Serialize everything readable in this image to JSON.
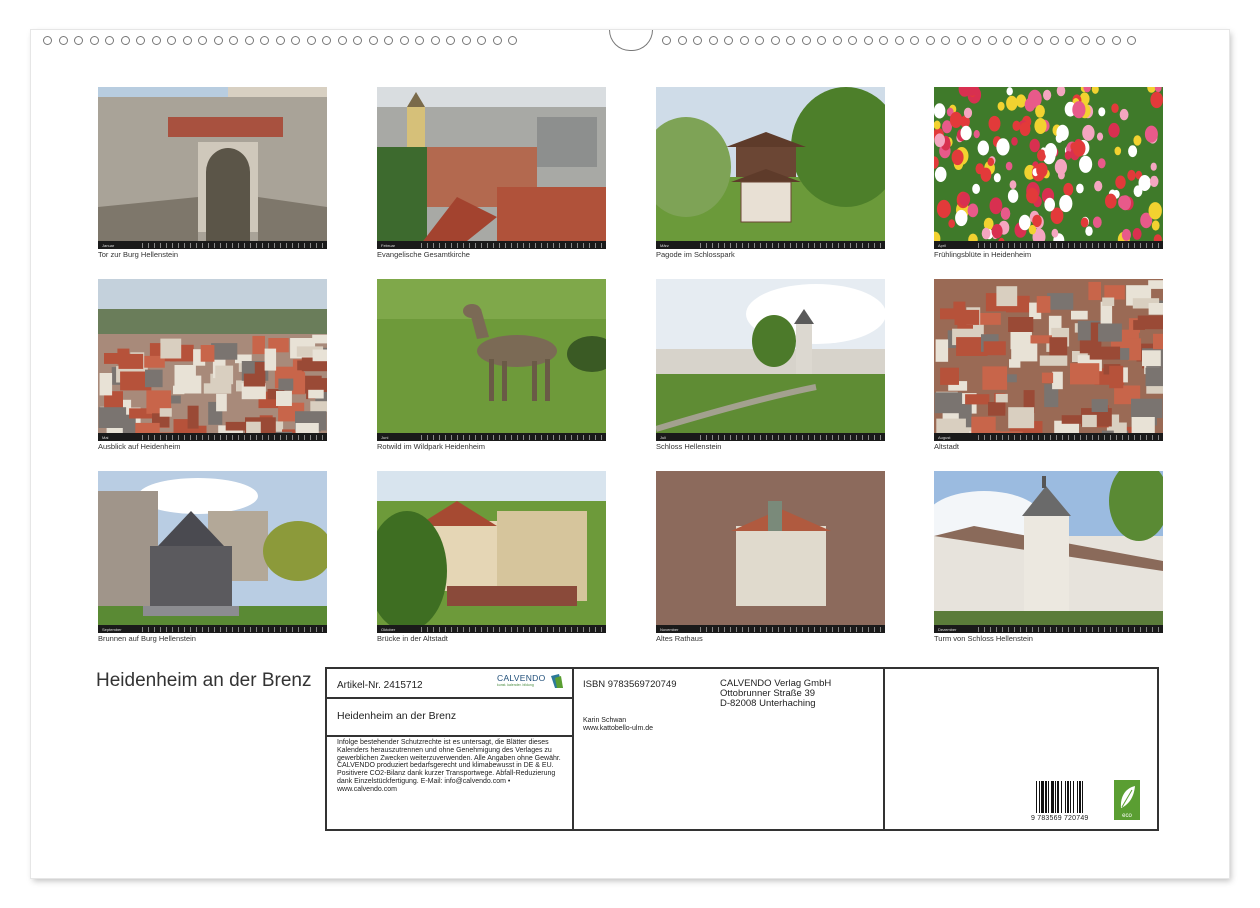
{
  "title": "Heidenheim an der Brenz",
  "photos": [
    {
      "caption": "Tor zur Burg Hellenstein",
      "month": "Januar",
      "scene": "gate"
    },
    {
      "caption": "Evangelische Gesamtkirche",
      "month": "Februar",
      "scene": "town"
    },
    {
      "caption": "Pagode im Schlosspark",
      "month": "März",
      "scene": "pagoda"
    },
    {
      "caption": "Frühlingsblüte in Heidenheim",
      "month": "April",
      "scene": "tulips"
    },
    {
      "caption": "Ausblick auf Heidenheim",
      "month": "Mai",
      "scene": "view"
    },
    {
      "caption": "Rotwild im Wildpark Heidenheim",
      "month": "Juni",
      "scene": "deer"
    },
    {
      "caption": "Schloss Hellenstein",
      "month": "Juli",
      "scene": "castle"
    },
    {
      "caption": "Altstadt",
      "month": "August",
      "scene": "roofs"
    },
    {
      "caption": "Brunnen auf Burg Hellenstein",
      "month": "September",
      "scene": "fountain"
    },
    {
      "caption": "Brücke in der Altstadt",
      "month": "Oktober",
      "scene": "bridge"
    },
    {
      "caption": "Altes Rathaus",
      "month": "November",
      "scene": "townhall"
    },
    {
      "caption": "Turm von Schloss Hellenstein",
      "month": "Dezember",
      "scene": "tower"
    }
  ],
  "info": {
    "article": "Artikel-Nr. 2415712",
    "brand": "CALVENDO",
    "brand_sub": "kunst. kalender. bildung",
    "book_title": "Heidenheim an der Brenz",
    "legal": "Infolge bestehender Schutzrechte ist es untersagt, die Blätter dieses Kalenders herauszutrennen und ohne Genehmigung des Verlages zu gewerblichen Zwecken weiterzuverwenden. Alle Angaben ohne Gewähr. CALVENDO produziert bedarfsgerecht und klimabewusst in DE & EU. Positivere CO2-Bilanz dank kurzer Transportwege. Abfall-Reduzierung dank Einzelstückfertigung. E-Mail: info@calvendo.com • www.calvendo.com",
    "isbn": "ISBN 9783569720749",
    "publisher_line1": "CALVENDO Verlag GmbH",
    "publisher_line2": "Ottobrunner Straße 39",
    "publisher_line3": "D-82008 Unterhaching",
    "author_name": "Karin Schwan",
    "author_url": "www.kattobello-ulm.de",
    "barcode_number": "9 783569 720749",
    "eco_label": "eco"
  },
  "colors": {
    "brand_blue": "#1f4e79",
    "eco_green": "#5a9e32"
  }
}
